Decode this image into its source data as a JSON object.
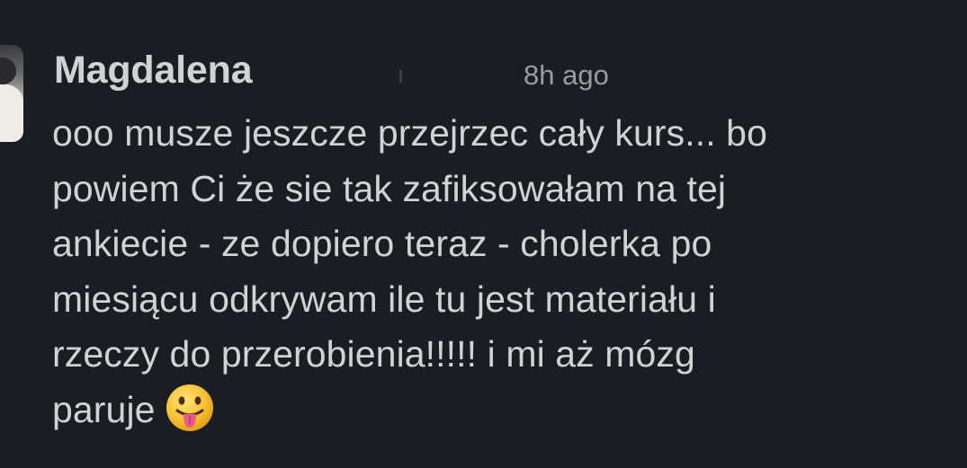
{
  "message": {
    "sender": "Magdalena",
    "timestamp": "8h ago",
    "lines": [
      "ooo musze jeszcze przejrzec cały kurs... bo",
      "powiem Ci że sie tak zafiksowałam na tej",
      "ankiecie - ze dopiero teraz - cholerka po",
      "miesiącu odkrywam ile tu jest materiału i",
      "rzeczy do przerobienia!!!!! i mi aż mózg",
      "paruje"
    ],
    "emoji": "face-with-tongue-icon"
  },
  "colors": {
    "background": "#1a1d21",
    "text": "#d1d2d3",
    "timestamp": "#9b9c9e",
    "emoji_face": "#f7c236",
    "emoji_tongue": "#e85a8a"
  }
}
